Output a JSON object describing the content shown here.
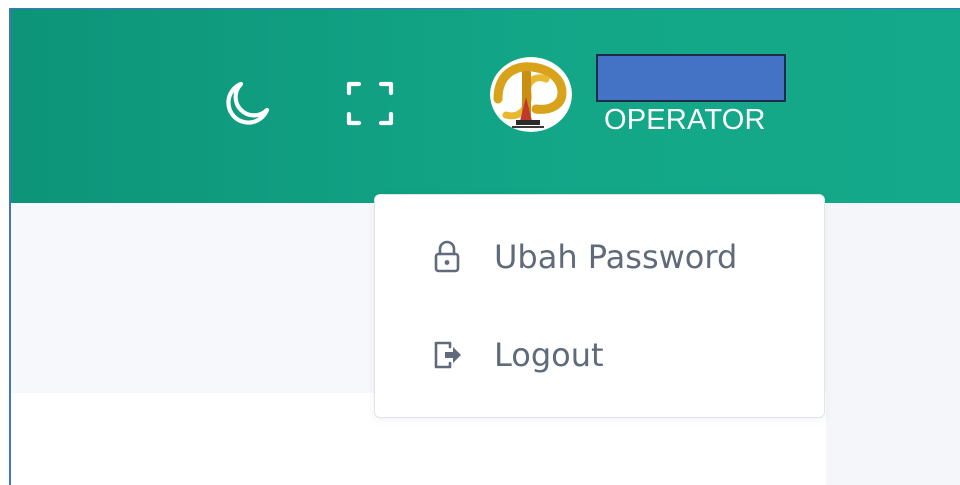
{
  "header": {
    "theme_toggle_icon": "moon-icon",
    "fullscreen_icon": "fullscreen-icon",
    "user": {
      "role": "OPERATOR",
      "avatar_icon": "logo-avatar-icon"
    }
  },
  "dropdown": {
    "items": [
      {
        "label": "Ubah Password",
        "icon": "lock-icon"
      },
      {
        "label": "Logout",
        "icon": "logout-icon"
      }
    ]
  },
  "colors": {
    "topbar": "#13a788",
    "name_redaction": "#4472c4",
    "menu_text": "#5f6b7a"
  }
}
